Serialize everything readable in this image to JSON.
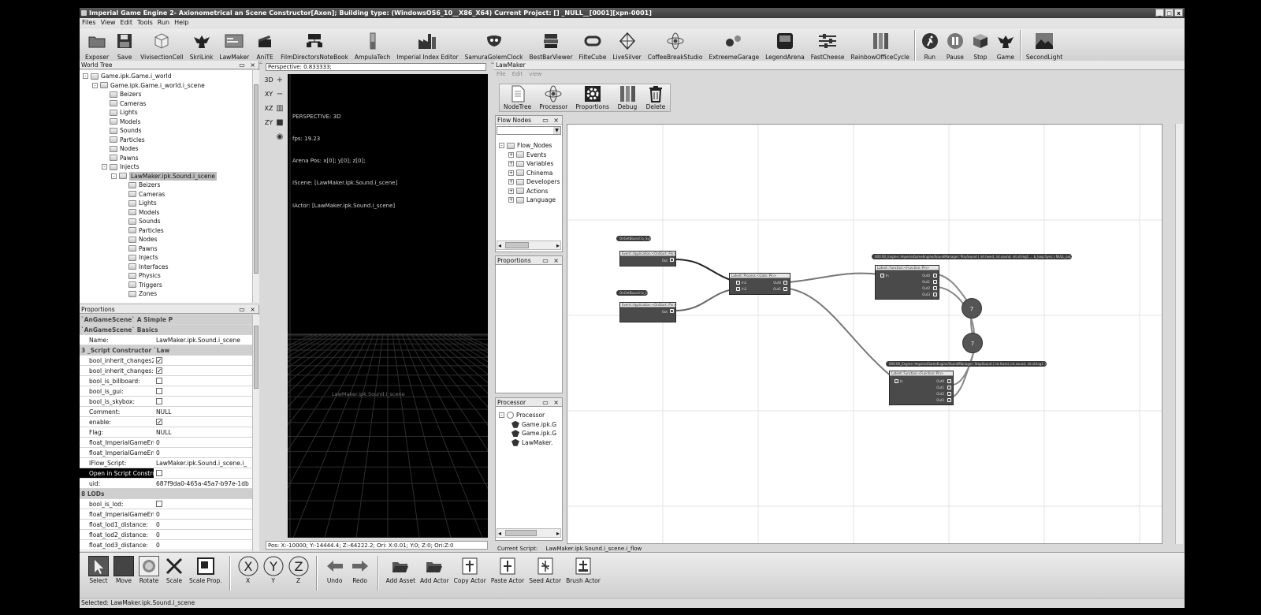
{
  "window": {
    "title": "Imperial Game Engine 2- Axionometrical an Scene Constructor[Axon]; Building type: (WindowsOS6_10__X86_X64) Current Project: [] _NULL__[0001][xpn-0001]",
    "btn_min": "_",
    "btn_max": "□",
    "btn_close": "x"
  },
  "menu": [
    "Files",
    "View",
    "Edit",
    "Tools",
    "Run",
    "Help"
  ],
  "toolbar": [
    {
      "label": "Exposer",
      "icon": "folder-icon"
    },
    {
      "label": "Save",
      "icon": "floppy-icon"
    },
    {
      "label": "VivisectionCell",
      "icon": "cube-icon"
    },
    {
      "label": "SkriLink",
      "icon": "eagle-icon"
    },
    {
      "label": "LawMaker",
      "icon": "code-window-icon"
    },
    {
      "label": "AniTE",
      "icon": "clapper-icon"
    },
    {
      "label": "FilmDirectorsNoteBook",
      "icon": "network-icon"
    },
    {
      "label": "AmpulaTech",
      "icon": "ampule-icon"
    },
    {
      "label": "Imperial Index Editor",
      "icon": "factory-icon"
    },
    {
      "label": "SamuraGolemClock",
      "icon": "mask-icon"
    },
    {
      "label": "BestBarViewer",
      "icon": "books-icon"
    },
    {
      "label": "FilteCube",
      "icon": "ring-icon"
    },
    {
      "label": "LiveSilver",
      "icon": "diamond-icon"
    },
    {
      "label": "CoffeeBreakStudio",
      "icon": "atom-icon"
    },
    {
      "label": "ExtreemeGarage",
      "icon": "molecule-icon"
    },
    {
      "label": "LegendArena",
      "icon": "disk-icon"
    },
    {
      "label": "FastCheese",
      "icon": "sliders-icon"
    },
    {
      "label": "RainbowOfficeCycle",
      "icon": "bars-icon"
    }
  ],
  "toolbar_run": [
    {
      "label": "Run",
      "icon": "runner-icon"
    },
    {
      "label": "Pause",
      "icon": "pause-icon"
    },
    {
      "label": "Stop",
      "icon": "stop-icon"
    },
    {
      "label": "Game",
      "icon": "eagle-icon"
    }
  ],
  "toolbar_extra": {
    "label": "SecondLight",
    "icon": "landscape-icon"
  },
  "world_tree": {
    "title": "World Tree",
    "items": [
      {
        "label": "Game.ipk.Game.i_world",
        "depth": 0,
        "exp": "-"
      },
      {
        "label": "Game.ipk.Game.i_world.i_scene",
        "depth": 1,
        "exp": "-"
      },
      {
        "label": "Beizers",
        "depth": 2
      },
      {
        "label": "Cameras",
        "depth": 2
      },
      {
        "label": "Lights",
        "depth": 2
      },
      {
        "label": "Models",
        "depth": 2
      },
      {
        "label": "Sounds",
        "depth": 2
      },
      {
        "label": "Particles",
        "depth": 2
      },
      {
        "label": "Nodes",
        "depth": 2
      },
      {
        "label": "Pawns",
        "depth": 2
      },
      {
        "label": "Injects",
        "depth": 2,
        "exp": "-"
      },
      {
        "label": "LawMaker.ipk.Sound.i_scene",
        "depth": 3,
        "exp": "-",
        "selected": true
      },
      {
        "label": "Beizers",
        "depth": 4
      },
      {
        "label": "Cameras",
        "depth": 4
      },
      {
        "label": "Lights",
        "depth": 4
      },
      {
        "label": "Models",
        "depth": 4
      },
      {
        "label": "Sounds",
        "depth": 4
      },
      {
        "label": "Particles",
        "depth": 4
      },
      {
        "label": "Nodes",
        "depth": 4
      },
      {
        "label": "Pawns",
        "depth": 4
      },
      {
        "label": "Injects",
        "depth": 4
      },
      {
        "label": "Interfaces",
        "depth": 4
      },
      {
        "label": "Physics",
        "depth": 4
      },
      {
        "label": "Triggers",
        "depth": 4
      },
      {
        "label": "Zones",
        "depth": 4
      }
    ]
  },
  "proportions": {
    "title": "Proportions",
    "rows": [
      {
        "section": "`AnGameScene` A Simple P"
      },
      {
        "section": "`AnGameScene` Basics"
      },
      {
        "k": "Name:",
        "v": "LawMaker.ipk.Sound.i_scene"
      },
      {
        "section": "3 _Script Constructor `Law"
      },
      {
        "k": "bool_inherit_changes2:",
        "check": true
      },
      {
        "k": "bool_inherit_changes:",
        "check": true
      },
      {
        "k": "bool_is_billboard:",
        "check": false
      },
      {
        "k": "bool_is_gui:",
        "check": false
      },
      {
        "k": "bool_is_skybox:",
        "check": false
      },
      {
        "k": "Comment:",
        "v": "NULL"
      },
      {
        "k": "enable:",
        "check": true
      },
      {
        "k": "Flag:",
        "v": "NULL"
      },
      {
        "k": "float_ImperialGameEngine",
        "v": "0"
      },
      {
        "k": "float_ImperialGameEngine",
        "v": "0"
      },
      {
        "k": "IFlow_Script:",
        "v": "LawMaker.ipk.Sound.i_scene.i_"
      },
      {
        "k": "Open in Script Constructor",
        "check": false,
        "selected": true
      },
      {
        "k": "uid:",
        "v": "687f9da0-465a-45a7-b97e-1db"
      },
      {
        "section": "8 LODs"
      },
      {
        "k": "bool_is_lod:",
        "check": false
      },
      {
        "k": "float_ImperialGameEngine",
        "v": "0"
      },
      {
        "k": "float_lod1_distance:",
        "v": "0"
      },
      {
        "k": "float_lod2_distance:",
        "v": "0"
      },
      {
        "k": "float_lod3_distance:",
        "v": "0"
      }
    ]
  },
  "viewport": {
    "perspective_field": "Perspective: 0.833333;",
    "axis_buttons": [
      "3D",
      "XY",
      "XZ",
      "ZY"
    ],
    "lines": [
      "PERSPECTIVE: 3D",
      "fps: 19.23",
      "Arena Pos: x[0]; y[0]; z[0];",
      "IScene: [LawMaker.ipk.Sound.i_scene]",
      "IActor: [LawMaker.ipk.Sound.i_scene]"
    ],
    "ghost_label": "LawMaker.ipk.Sound.i_scene",
    "status": "Pos: X:-10000; Y:-14444.4; Z:-64222.2; Ori: X:0.01; Y:0; Z:0; Ori:Z:0"
  },
  "lawmaker": {
    "title": "LawMaker",
    "menu": [
      "File",
      "Edit",
      "view"
    ],
    "tools": [
      {
        "label": "NodeTree",
        "icon": "doc-icon"
      },
      {
        "label": "Processor",
        "icon": "atom-icon"
      },
      {
        "label": "Proportions",
        "icon": "gear-icon"
      },
      {
        "label": "Debug",
        "icon": "bars-icon"
      },
      {
        "label": "Delete",
        "icon": "trash-icon"
      }
    ],
    "flow_nodes": {
      "title": "Flow Nodes",
      "root": "Flow_Nodes",
      "items": [
        "Events",
        "Variables",
        "Chinema",
        "Developers",
        "Actions",
        "Language"
      ]
    },
    "proportions_title": "Proportions",
    "processor": {
      "title": "Processor",
      "root": "Processor",
      "items": [
        "Game.ipk.G",
        "Game.ipk.G",
        "LawMaker."
      ]
    },
    "current_script_label": "Current Script:",
    "current_script": "LawMaker.ipk.Sound.i_scene.i_flow",
    "graph": {
      "n1": {
        "pill": "OnGetBound::b_Sync",
        "head": "Event::Application:<OnStart::Pin>",
        "out": "Out"
      },
      "n2": {
        "pill": "OnGetBound::b_Off",
        "head": "Event::Application:<OnStart::Pin>",
        "out": "Out"
      },
      "n3": {
        "head": "Latent::Process:<Gate::Pin>",
        "in1": "In1",
        "in2": "In2",
        "out1": "Out0",
        "out2": "Out1"
      },
      "n4": {
        "pill": "000:00_Engine::ImperialGameEngine/SoundManager::PlaySound ( int.hwnd, int.sound, int.string1 ... b_loop:Sync ) NULL_out: 1",
        "head": "Latent::Function:<Function::Pin>",
        "in": "In",
        "outs": [
          "Out0",
          "Out1",
          "Out2",
          "Out3"
        ]
      },
      "n5": {
        "pill": "000:00_Engine::ImperialGameEngine/SoundManager::StopSound ( int.hwnd, int.sound, int.string1 ) NULL_out: 2",
        "head": "Latent::Function:<Function::Pin>",
        "in": "In",
        "outs": [
          "Out0",
          "Out1",
          "Out2",
          "Out3"
        ]
      },
      "seq_a": "7",
      "seq_b": "7"
    }
  },
  "bottom_tools": [
    {
      "label": "Select",
      "icon": "cursor-icon"
    },
    {
      "label": "Move",
      "icon": "move-icon"
    },
    {
      "label": "Rotate",
      "icon": "rotate-icon"
    },
    {
      "label": "Scale",
      "icon": "scale-icon"
    },
    {
      "label": "Scale Prop.",
      "icon": "scale-prop-icon"
    },
    {
      "label": "X",
      "icon": "axis-x-icon"
    },
    {
      "label": "Y",
      "icon": "axis-y-icon"
    },
    {
      "label": "Z",
      "icon": "axis-z-icon"
    },
    {
      "label": "Undo",
      "icon": "undo-icon"
    },
    {
      "label": "Redo",
      "icon": "redo-icon"
    },
    {
      "label": "Add Asset",
      "icon": "open-folder-icon"
    },
    {
      "label": "Add Actor",
      "icon": "open-folder-icon"
    },
    {
      "label": "Copy Actor",
      "icon": "copy-actor-icon"
    },
    {
      "label": "Paste Actor",
      "icon": "paste-actor-icon"
    },
    {
      "label": "Seed Actor",
      "icon": "seed-actor-icon"
    },
    {
      "label": "Brush Actor",
      "icon": "brush-actor-icon"
    }
  ],
  "status_bar": "Selected: LawMaker.ipk.Sound.i_scene"
}
